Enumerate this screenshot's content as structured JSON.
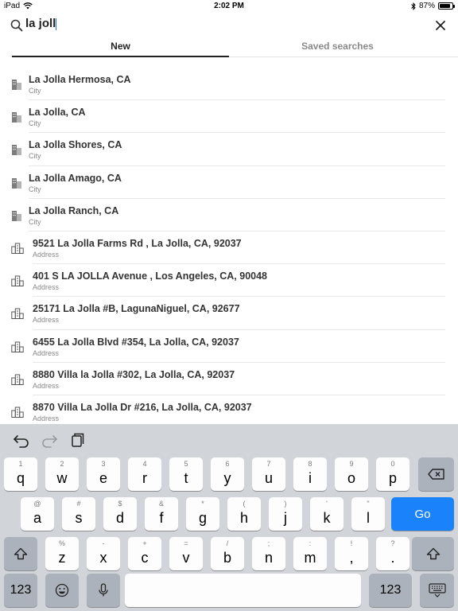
{
  "status_bar": {
    "device": "iPad",
    "time": "2:02 PM",
    "battery": "87%",
    "battery_level": 0.87
  },
  "search": {
    "value": "la joll"
  },
  "tabs": [
    {
      "label": "New",
      "active": true
    },
    {
      "label": "Saved searches",
      "active": false
    }
  ],
  "results": [
    {
      "title": "La Jolla Hermosa, CA",
      "type": "City",
      "icon": "city-icon"
    },
    {
      "title": "La Jolla, CA",
      "type": "City",
      "icon": "city-icon"
    },
    {
      "title": "La Jolla Shores, CA",
      "type": "City",
      "icon": "city-icon"
    },
    {
      "title": "La Jolla Amago, CA",
      "type": "City",
      "icon": "city-icon"
    },
    {
      "title": "La Jolla Ranch, CA",
      "type": "City",
      "icon": "city-icon"
    },
    {
      "title": "9521 La Jolla Farms Rd , La Jolla, CA, 92037",
      "type": "Address",
      "icon": "address-icon"
    },
    {
      "title": "401 S LA JOLLA Avenue , Los Angeles, CA, 90048",
      "type": "Address",
      "icon": "address-icon"
    },
    {
      "title": "25171 La Jolla #B, LagunaNiguel, CA, 92677",
      "type": "Address",
      "icon": "address-icon"
    },
    {
      "title": "6455 La Jolla Blvd #354, La Jolla, CA, 92037",
      "type": "Address",
      "icon": "address-icon"
    },
    {
      "title": "8880 Villa la Jolla #302, La Jolla, CA, 92037",
      "type": "Address",
      "icon": "address-icon"
    },
    {
      "title": "8870 Villa La Jolla Dr #216, La Jolla, CA, 92037",
      "type": "Address",
      "icon": "address-icon"
    }
  ],
  "keyboard": {
    "toolbar": [
      "undo-icon",
      "redo-icon",
      "paste-icon"
    ],
    "row1": [
      {
        "hint": "1",
        "key": "q"
      },
      {
        "hint": "2",
        "key": "w"
      },
      {
        "hint": "3",
        "key": "e"
      },
      {
        "hint": "4",
        "key": "r"
      },
      {
        "hint": "5",
        "key": "t"
      },
      {
        "hint": "6",
        "key": "y"
      },
      {
        "hint": "7",
        "key": "u"
      },
      {
        "hint": "8",
        "key": "i"
      },
      {
        "hint": "9",
        "key": "o"
      },
      {
        "hint": "0",
        "key": "p"
      }
    ],
    "row2": [
      {
        "hint": "@",
        "key": "a"
      },
      {
        "hint": "#",
        "key": "s"
      },
      {
        "hint": "$",
        "key": "d"
      },
      {
        "hint": "&",
        "key": "f"
      },
      {
        "hint": "*",
        "key": "g"
      },
      {
        "hint": "(",
        "key": "h"
      },
      {
        "hint": ")",
        "key": "j"
      },
      {
        "hint": "'",
        "key": "k"
      },
      {
        "hint": "\"",
        "key": "l"
      }
    ],
    "row3": [
      {
        "hint": "%",
        "key": "z"
      },
      {
        "hint": "-",
        "key": "x"
      },
      {
        "hint": "+",
        "key": "c"
      },
      {
        "hint": "=",
        "key": "v"
      },
      {
        "hint": "/",
        "key": "b"
      },
      {
        "hint": ";",
        "key": "n"
      },
      {
        "hint": ":",
        "key": "m"
      },
      {
        "hint": "!",
        "key": ","
      },
      {
        "hint": "?",
        "key": "."
      }
    ],
    "go_label": "Go",
    "numbers_label": "123"
  },
  "colors": {
    "accent": "#1a82fb",
    "keyboard_bg": "#d1d4d9",
    "key_dark": "#acb2bb"
  }
}
